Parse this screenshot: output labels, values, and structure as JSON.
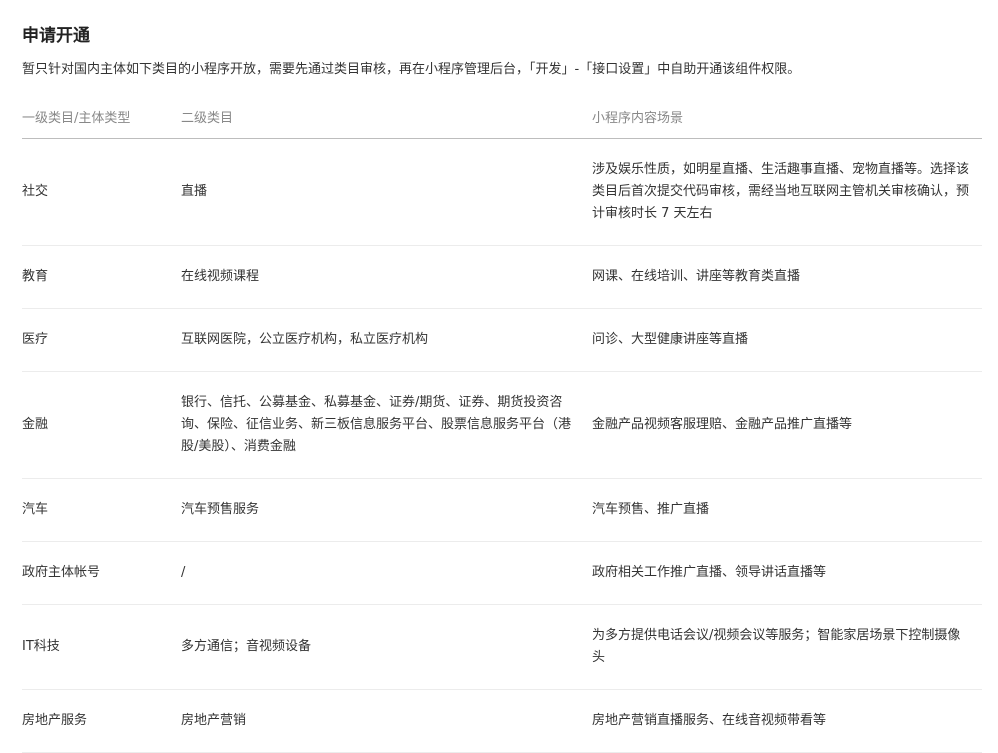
{
  "page": {
    "title": "申请开通",
    "description": "暂只针对国内主体如下类目的小程序开放，需要先通过类目审核，再在小程序管理后台，「开发」-「接口设置」中自助开通该组件权限。"
  },
  "table": {
    "headers": [
      "一级类目/主体类型",
      "二级类目",
      "小程序内容场景"
    ],
    "rows": [
      {
        "c1": "社交",
        "c2": "直播",
        "c3": "涉及娱乐性质，如明星直播、生活趣事直播、宠物直播等。选择该类目后首次提交代码审核，需经当地互联网主管机关审核确认，预计审核时长 7 天左右"
      },
      {
        "c1": "教育",
        "c2": "在线视频课程",
        "c3": "网课、在线培训、讲座等教育类直播"
      },
      {
        "c1": "医疗",
        "c2": "互联网医院，公立医疗机构，私立医疗机构",
        "c3": "问诊、大型健康讲座等直播"
      },
      {
        "c1": "金融",
        "c2": "银行、信托、公募基金、私募基金、证券/期货、证券、期货投资咨询、保险、征信业务、新三板信息服务平台、股票信息服务平台（港股/美股）、消费金融",
        "c3": "金融产品视频客服理赔、金融产品推广直播等"
      },
      {
        "c1": "汽车",
        "c2": "汽车预售服务",
        "c3": "汽车预售、推广直播"
      },
      {
        "c1": "政府主体帐号",
        "c2": "/",
        "c3": "政府相关工作推广直播、领导讲话直播等"
      },
      {
        "c1": "IT科技",
        "c2": "多方通信；音视频设备",
        "c3": "为多方提供电话会议/视频会议等服务；智能家居场景下控制摄像头"
      },
      {
        "c1": "房地产服务",
        "c2": "房地产营销",
        "c3": "房地产营销直播服务、在线音视频带看等"
      }
    ]
  }
}
